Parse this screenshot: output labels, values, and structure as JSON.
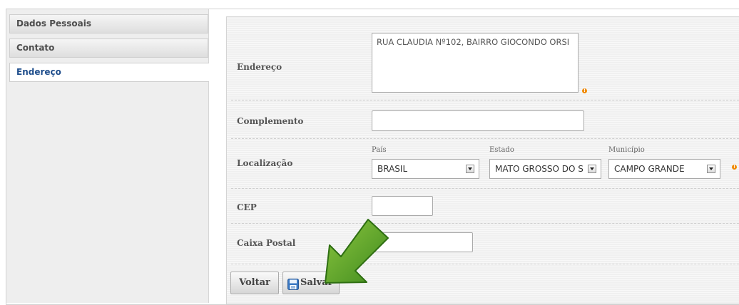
{
  "sidebar": {
    "items": [
      {
        "label": "Dados Pessoais",
        "active": false
      },
      {
        "label": "Contato",
        "active": false
      },
      {
        "label": "Endereço",
        "active": true
      }
    ]
  },
  "form": {
    "endereco": {
      "label": "Endereço",
      "value": "RUA CLAUDIA Nº102, BAIRRO GIOCONDO ORSI",
      "required": true
    },
    "complemento": {
      "label": "Complemento",
      "value": ""
    },
    "localizacao": {
      "label": "Localização",
      "pais": {
        "label": "País",
        "selected": "BRASIL"
      },
      "estado": {
        "label": "Estado",
        "selected": "MATO GROSSO DO S"
      },
      "municipio": {
        "label": "Município",
        "selected": "CAMPO GRANDE"
      },
      "required": true
    },
    "cep": {
      "label": "CEP",
      "value": ""
    },
    "caixa_postal": {
      "label": "Caixa Postal",
      "value": ""
    }
  },
  "buttons": {
    "voltar": "Voltar",
    "salvar": "Salvar"
  },
  "icons": {
    "required": "exclamation-icon",
    "save": "floppy-disk-icon",
    "annotation": "green-arrow-pointer"
  },
  "colors": {
    "required": "#f08a00",
    "active_tab_text": "#1f4e8c",
    "annotation_arrow": "#5a9e2a"
  }
}
